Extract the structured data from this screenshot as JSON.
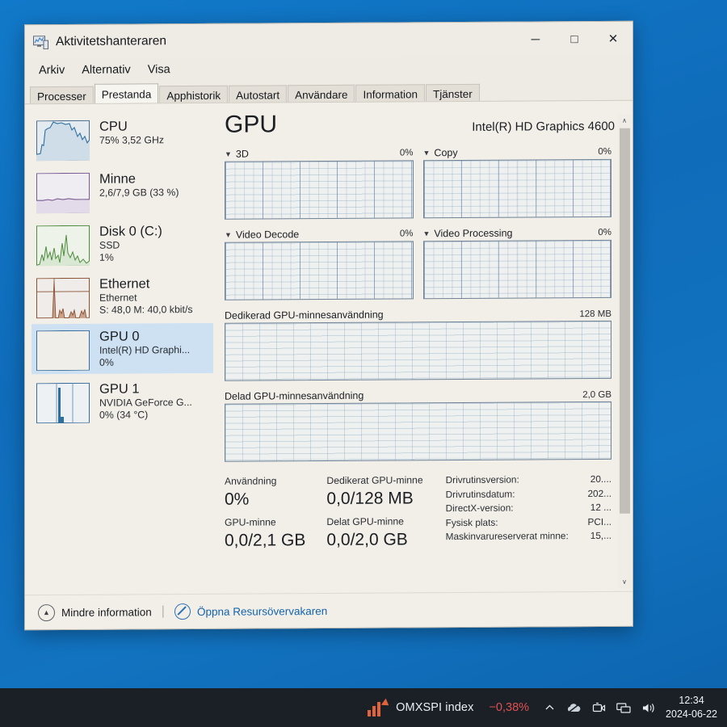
{
  "window": {
    "title": "Aktivitetshanteraren",
    "icon": "task-manager-icon",
    "minimize": "─",
    "maximize": "□",
    "close": "✕"
  },
  "menubar": {
    "items": [
      "Arkiv",
      "Alternativ",
      "Visa"
    ]
  },
  "tabs": [
    {
      "label": "Processer",
      "active": false
    },
    {
      "label": "Prestanda",
      "active": true
    },
    {
      "label": "Apphistorik",
      "active": false
    },
    {
      "label": "Autostart",
      "active": false
    },
    {
      "label": "Användare",
      "active": false
    },
    {
      "label": "Information",
      "active": false
    },
    {
      "label": "Tjänster",
      "active": false
    }
  ],
  "sidebar": {
    "items": [
      {
        "name": "CPU",
        "line1": "75% 3,52 GHz",
        "line2": "",
        "selected": false,
        "color": "#3d6fa5"
      },
      {
        "name": "Minne",
        "line1": "2,6/7,9 GB (33 %)",
        "line2": "",
        "selected": false,
        "color": "#8a5ba8"
      },
      {
        "name": "Disk 0 (C:)",
        "line1": "SSD",
        "line2": "1%",
        "selected": false,
        "color": "#4e9b3f"
      },
      {
        "name": "Ethernet",
        "line1": "Ethernet",
        "line2": "S: 48,0 M: 40,0 kbit/s",
        "selected": false,
        "color": "#8a5234"
      },
      {
        "name": "GPU 0",
        "line1": "Intel(R) HD Graphi...",
        "line2": "0%",
        "selected": true,
        "color": "#2d6fa8"
      },
      {
        "name": "GPU 1",
        "line1": "NVIDIA GeForce G...",
        "line2": "0% (34 °C)",
        "selected": false,
        "color": "#2d6fa8"
      }
    ]
  },
  "main": {
    "heading": "GPU",
    "model": "Intel(R) HD Graphics 4600",
    "engines": [
      {
        "label": "3D",
        "value": "0%"
      },
      {
        "label": "Copy",
        "value": "0%"
      },
      {
        "label": "Video Decode",
        "value": "0%"
      },
      {
        "label": "Video Processing",
        "value": "0%"
      }
    ],
    "memory_graphs": [
      {
        "label": "Dedikerad GPU-minnesanvändning",
        "value": "128 MB"
      },
      {
        "label": "Delad GPU-minnesanvändning",
        "value": "2,0 GB"
      }
    ],
    "stats": [
      {
        "label": "Användning",
        "value": "0%"
      },
      {
        "label": "GPU-minne",
        "value": "0,0/2,1 GB"
      },
      {
        "label": "Dedikerat GPU-minne",
        "value": "0,0/128 MB"
      },
      {
        "label": "Delat GPU-minne",
        "value": "0,0/2,0 GB"
      }
    ],
    "system_info": [
      {
        "key": "Drivrutinsversion:",
        "value": "20...."
      },
      {
        "key": "Drivrutinsdatum:",
        "value": "202..."
      },
      {
        "key": "DirectX-version:",
        "value": "12 ..."
      },
      {
        "key": "Fysisk plats:",
        "value": "PCI..."
      },
      {
        "key": "Maskinvarureserverat minne:",
        "value": "15,..."
      }
    ],
    "scroll_up": "∧",
    "scroll_down": "∨"
  },
  "footer": {
    "less_info_icon": "chevron-up-circle-icon",
    "less_info_label": "Mindre information",
    "separator": "|",
    "resource_monitor_icon": "resource-monitor-icon",
    "resource_monitor_label": "Öppna Resursövervakaren"
  },
  "taskbar": {
    "stock_icon": "stock-ticker-icon",
    "stock_name": "OMXSPI index",
    "stock_delta": "−0,38%",
    "stock_delta_color": "#e05050",
    "tray": [
      "chevron-up-icon",
      "cloud-offline-icon",
      "camera-icon",
      "network-icon",
      "volume-icon"
    ],
    "time": "12:34",
    "date": "2024-06-22"
  },
  "colors": {
    "desktop": "#0f6cba",
    "taskbar": "#1b2027",
    "window_bg": "#f2efe9",
    "selection": "#cde1f3",
    "link": "#1263ad",
    "graph_border": "#6f8296"
  }
}
